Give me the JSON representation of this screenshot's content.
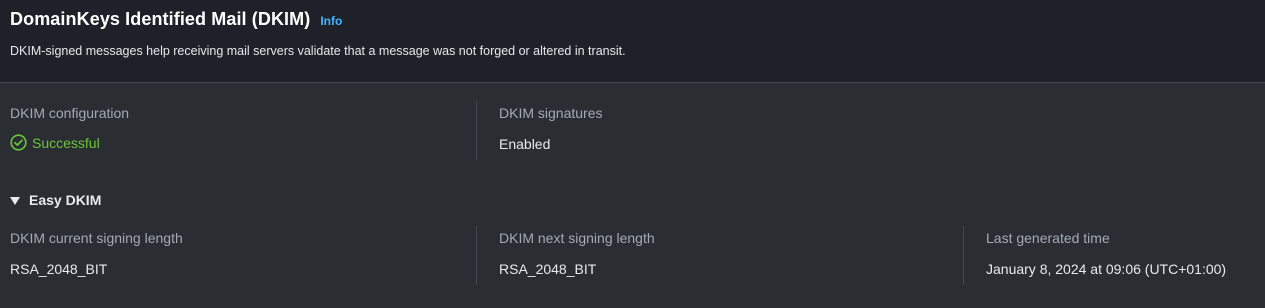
{
  "header": {
    "title": "DomainKeys Identified Mail (DKIM)",
    "info_link": "Info",
    "description": "DKIM-signed messages help receiving mail servers validate that a message was not forged or altered in transit."
  },
  "summary": {
    "configuration": {
      "label": "DKIM configuration",
      "value": "Successful",
      "icon": "check-circle-icon",
      "status_color": "#6bc43a"
    },
    "signatures": {
      "label": "DKIM signatures",
      "value": "Enabled"
    }
  },
  "easy_dkim": {
    "label": "Easy DKIM",
    "expanded": true,
    "current_length": {
      "label": "DKIM current signing length",
      "value": "RSA_2048_BIT"
    },
    "next_length": {
      "label": "DKIM next signing length",
      "value": "RSA_2048_BIT"
    },
    "last_generated": {
      "label": "Last generated time",
      "value": "January 8, 2024 at 09:06 (UTC+01:00)"
    }
  },
  "colors": {
    "background": "#2a2e33",
    "header_background": "#1e2228",
    "link": "#42b4ff",
    "success": "#6bc43a",
    "divider": "#414750"
  }
}
